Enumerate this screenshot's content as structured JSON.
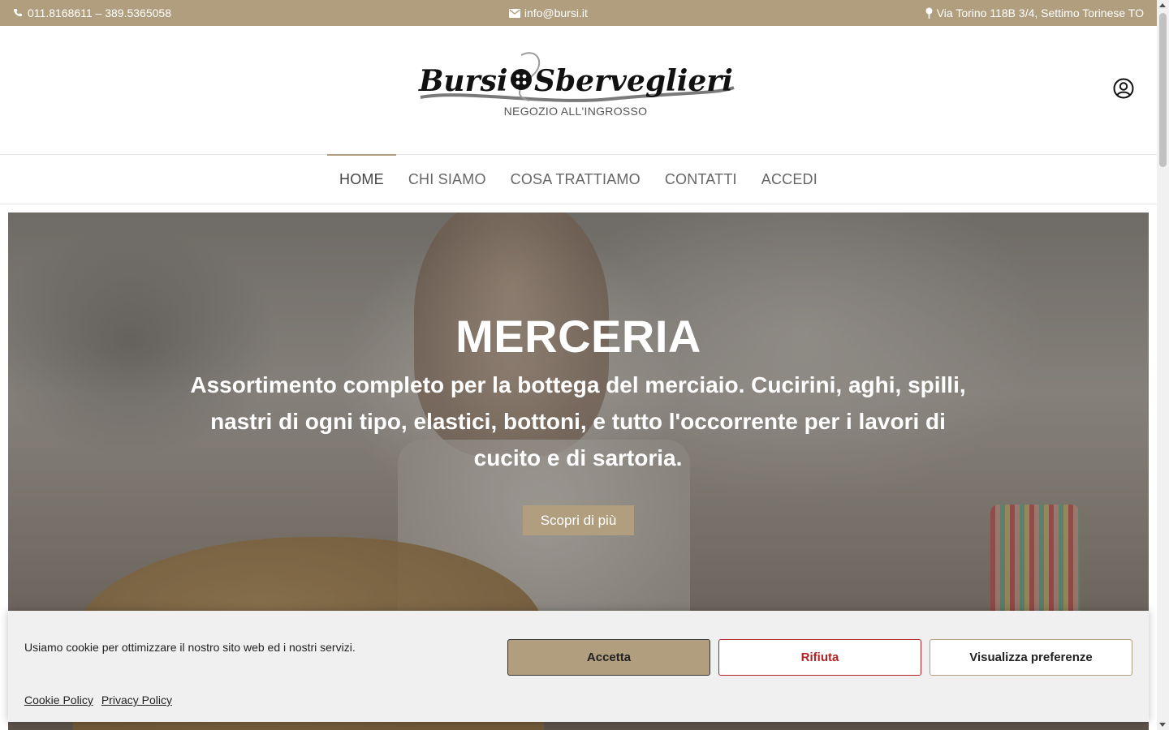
{
  "topbar": {
    "phone": "011.8168611 – 389.5365058",
    "email": "info@bursi.it",
    "address": "Via Torino 118B 3/4, Settimo Torinese TO",
    "icons": [
      "phone-icon",
      "envelope-icon",
      "map-pin-icon"
    ]
  },
  "header": {
    "logo_text": "Bursi&Sberveglieri",
    "logo_left": "Bursi",
    "logo_right": "Sberveglieri",
    "tagline": "NEGOZIO ALL'INGROSSO",
    "user_icon": "user-circle-icon"
  },
  "nav": {
    "items": [
      {
        "label": "HOME",
        "active": true
      },
      {
        "label": "CHI SIAMO",
        "active": false
      },
      {
        "label": "COSA TRATTIAMO",
        "active": false
      },
      {
        "label": "CONTATTI",
        "active": false
      },
      {
        "label": "ACCEDI",
        "active": false
      }
    ]
  },
  "hero": {
    "title": "MERCERIA",
    "text": "Assortimento completo per la bottega del merciaio. Cucirini, aghi, spilli, nastri di ogni tipo, elastici, bottoni, e tutto l'occorrente per i lavori di cucito e di sartoria.",
    "button": "Scopri di più"
  },
  "cookie": {
    "message": "Usiamo cookie per ottimizzare il nostro sito web ed i nostri servizi.",
    "accept": "Accetta",
    "reject": "Rifiuta",
    "preferences": "Visualizza preferenze",
    "cookie_policy": "Cookie Policy",
    "privacy_policy": "Privacy Policy"
  },
  "colors": {
    "brand": "#b19e7f",
    "reject": "#b22222",
    "banner_bg": "#f0f0f0"
  }
}
